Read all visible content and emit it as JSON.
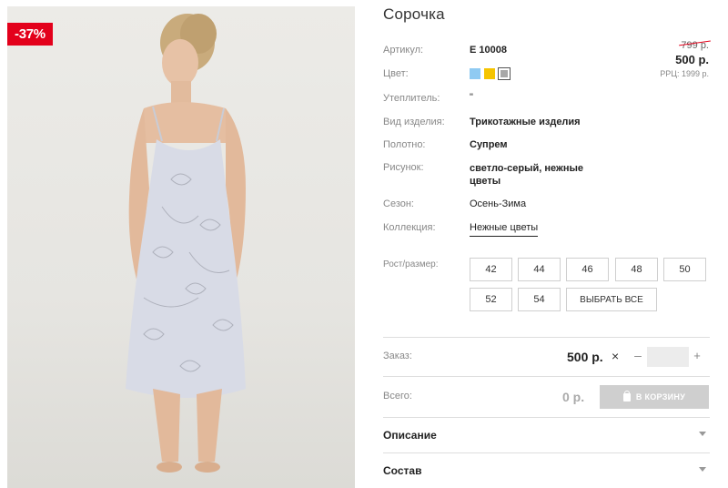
{
  "product": {
    "title": "Сорочка",
    "discount_badge": "-37%"
  },
  "attributes": [
    {
      "label": "Артикул:",
      "value": "Е 10008"
    },
    {
      "label": "Цвет:",
      "value": ""
    },
    {
      "label": "Утеплитель:",
      "value": "\""
    },
    {
      "label": "Вид изделия:",
      "value": "Трикотажные изделия"
    },
    {
      "label": "Полотно:",
      "value": "Супрем"
    },
    {
      "label": "Рисунок:",
      "value_line1": "светло-серый, нежные",
      "value_line2": "цветы"
    },
    {
      "label": "Сезон:",
      "value": "Осень-Зима"
    },
    {
      "label": "Коллекция:",
      "value": "Нежные цветы"
    }
  ],
  "colors": [
    {
      "name": "light-blue",
      "hex": "#8fcaf2"
    },
    {
      "name": "yellow",
      "hex": "#f5c400"
    },
    {
      "name": "grey",
      "hex": "#a8a8a8",
      "selected": true
    }
  ],
  "price": {
    "old": "799 р.",
    "new": "500 р.",
    "rrc": "РРЦ: 1999 р."
  },
  "sizes": {
    "label": "Рост/размер:",
    "options": [
      "42",
      "44",
      "46",
      "48",
      "50",
      "52",
      "54"
    ],
    "select_all": "ВЫБРАТЬ ВСЕ"
  },
  "order": {
    "label": "Заказ:",
    "price": "500 р.",
    "times": "×",
    "minus": "–",
    "plus": "+",
    "quantity": ""
  },
  "total": {
    "label": "Всего:",
    "value": "0 р.",
    "cart_button": "В КОРЗИНУ"
  },
  "accordion": [
    {
      "title": "Описание"
    },
    {
      "title": "Состав"
    }
  ],
  "theme": {
    "badge_red": "#e3001b",
    "button_disabled": "#cfcfcf"
  }
}
